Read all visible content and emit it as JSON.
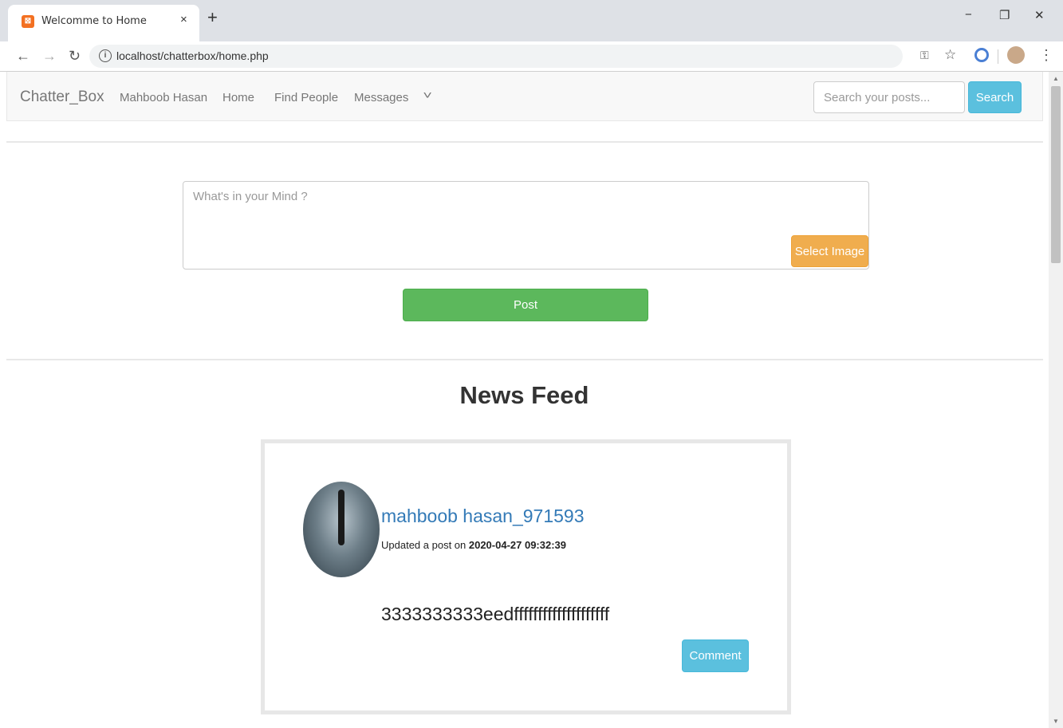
{
  "browser": {
    "tab_title": "Welcomme to Home",
    "tab_close": "×",
    "new_tab": "+",
    "url": "localhost/chatterbox/home.php",
    "win_minimize": "−",
    "win_maximize": "❐",
    "win_close": "✕"
  },
  "navbar": {
    "brand": "Chatter_Box",
    "links": [
      "Mahboob Hasan",
      "Home",
      "Find People",
      "Messages"
    ],
    "search_placeholder": "Search your posts...",
    "search_label": "Search"
  },
  "composer": {
    "placeholder": "What's in your Mind ?",
    "select_image_label": "Select Image",
    "post_label": "Post"
  },
  "feed": {
    "title": "News Feed",
    "posts": [
      {
        "user": "mahboob hasan_971593",
        "meta_prefix": "Updated a post on ",
        "timestamp": "2020-04-27 09:32:39",
        "content": "3333333333eedffffffffffffffffffff",
        "comment_label": "Comment"
      }
    ]
  },
  "icons": {
    "back": "back-arrow-icon",
    "forward": "forward-arrow-icon",
    "reload": "reload-icon",
    "info": "info-icon",
    "key": "key-icon",
    "star": "star-icon",
    "menu": "kebab-menu-icon",
    "caret": "chevron-down-icon"
  }
}
